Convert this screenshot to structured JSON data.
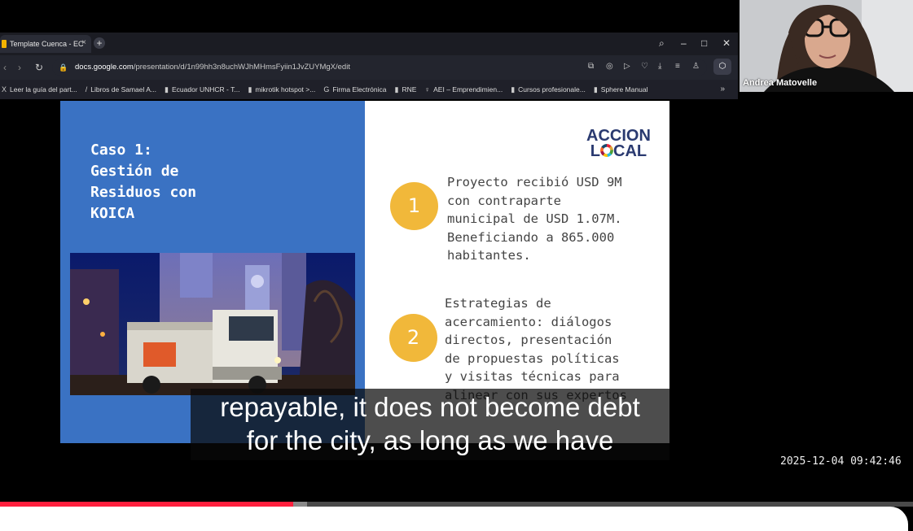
{
  "browser": {
    "tab_title": "Template Cuenca - EC",
    "tab_close": "×",
    "new_tab": "+",
    "window_controls": {
      "search": "⌕",
      "minimize": "–",
      "maximize": "□",
      "close": "✕"
    },
    "nav": {
      "back": "‹",
      "forward": "›",
      "reload": "↻",
      "lock": "🔒"
    },
    "url_domain": "docs.google.com",
    "url_path": "/presentation/d/1n99hh3n8uchWJhMHmsFyiin1JvZUYMgX/edit",
    "url_icons": [
      "⧉",
      "◎",
      "▷",
      "♡",
      "⤓",
      "≡",
      "♙"
    ],
    "extension_icon": "⬡",
    "bookmarks": [
      {
        "icon": "X",
        "label": "Leer la guía del part..."
      },
      {
        "icon": "/",
        "label": "Libros de Samael A..."
      },
      {
        "icon": "▮",
        "label": "Ecuador UNHCR - T..."
      },
      {
        "icon": "▮",
        "label": "mikrotik hotspot >..."
      },
      {
        "icon": "G",
        "label": "Firma Electrónica"
      },
      {
        "icon": "▮",
        "label": "RNE"
      },
      {
        "icon": "♀",
        "label": "AEI – Emprendimien..."
      },
      {
        "icon": "▮",
        "label": "Cursos profesionale..."
      },
      {
        "icon": "▮",
        "label": "Sphere Manual"
      }
    ],
    "bookmarks_more": "»"
  },
  "slide": {
    "title": "Caso 1:\nGestión de\nResiduos con\nKOICA",
    "logo_line1": "ACCION",
    "logo_line2_a": "L",
    "logo_line2_b": "CAL",
    "items": [
      {
        "number": "1",
        "text": "Proyecto recibió USD 9M\ncon contraparte\nmunicipal de USD 1.07M.\nBeneficiando a 865.000\nhabitantes."
      },
      {
        "number": "2",
        "text": "Estrategias de\nacercamiento: diálogos\ndirectos, presentación\nde propuestas políticas\ny visitas técnicas para\nalinear con sus expertos"
      }
    ],
    "colors": {
      "left_panel": "#3a72c3",
      "number_circle": "#f1b83a"
    }
  },
  "captions": {
    "line1": "repayable, it does not become debt",
    "line2": "for the city, as long as we have"
  },
  "participant": {
    "name": "Andrea Matovelle"
  },
  "timestamp": "2025-12-04 09:42:46",
  "player": {
    "played_fraction": 0.321,
    "buffered_fraction": 0.336,
    "played_color": "#ff1f3d"
  }
}
